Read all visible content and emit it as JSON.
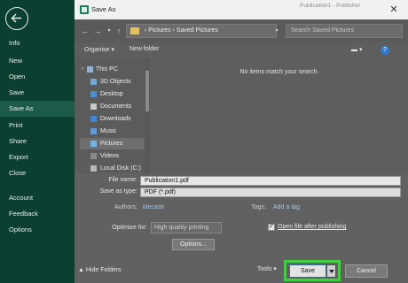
{
  "backstage": {
    "items": [
      "Info",
      "New",
      "Open",
      "Save",
      "Save As",
      "Print",
      "Share",
      "Export",
      "Close",
      "Account",
      "Feedback",
      "Options"
    ],
    "active": "Save As"
  },
  "background_title": "Publication1 - Publisher",
  "dialog": {
    "title": "Save As",
    "breadcrumb": "›  Pictures  ›  Saved Pictures",
    "search_placeholder": "Search Saved Pictures",
    "toolbar": {
      "organise": "Organise ▾",
      "new_folder": "New folder"
    },
    "tree": [
      "This PC",
      "3D Objects",
      "Desktop",
      "Documents",
      "Downloads",
      "Music",
      "Pictures",
      "Videos",
      "Local Disk (C:)"
    ],
    "tree_selected": "Pictures",
    "empty_message": "No items match your search.",
    "file_name_label": "File name:",
    "file_name_value": "Publication1.pdf",
    "save_type_label": "Save as type:",
    "save_type_value": "PDF (*.pdf)",
    "authors_label": "Authors:",
    "authors_value": "idecastr",
    "tags_label": "Tags:",
    "tags_value": "Add a tag",
    "optimize_label": "Optimize for:",
    "optimize_value": "High quality printing",
    "options_button": "Options...",
    "open_after_label": "Open file after publishing",
    "hide_folders": "▲ Hide Folders",
    "tools": "Tools ▾",
    "save": "Save",
    "cancel": "Cancel",
    "help": "?"
  }
}
